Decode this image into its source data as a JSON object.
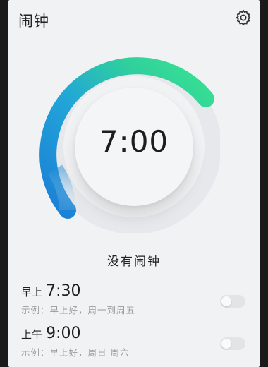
{
  "header": {
    "title": "闹钟",
    "settings_icon": "gear-icon"
  },
  "dial": {
    "time": "7:00",
    "arc_colors": [
      "#1f8fe0",
      "#34d08c",
      "#3ae38f"
    ]
  },
  "status": {
    "text": "没有闹钟"
  },
  "alarms": [
    {
      "ampm": "早上",
      "time": "7:30",
      "subtitle": "示例：早上好，周一到周五",
      "enabled": false
    },
    {
      "ampm": "上午",
      "time": "9:00",
      "subtitle": "示例：早上好，周日 周六",
      "enabled": false
    }
  ]
}
